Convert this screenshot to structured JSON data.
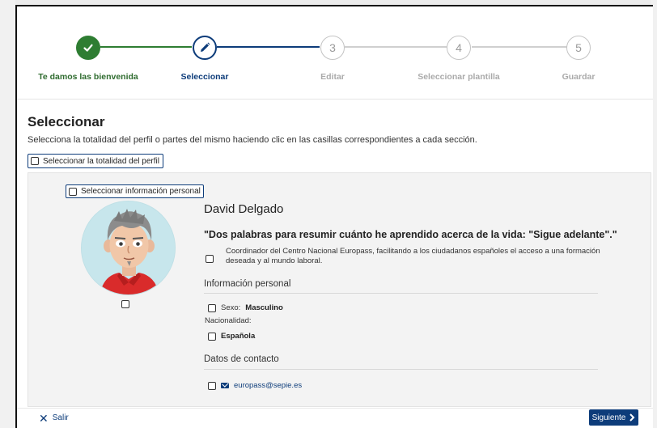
{
  "stepper": {
    "steps": [
      {
        "number": "1",
        "label": "Te damos las bienvenida",
        "state": "done"
      },
      {
        "number": "2",
        "label": "Seleccionar",
        "state": "active"
      },
      {
        "number": "3",
        "label": "Editar",
        "state": "pending"
      },
      {
        "number": "4",
        "label": "Seleccionar plantilla",
        "state": "pending"
      },
      {
        "number": "5",
        "label": "Guardar",
        "state": "pending"
      }
    ]
  },
  "page": {
    "title": "Seleccionar",
    "description": "Selecciona la totalidad del perfil o partes del mismo haciendo clic en las casillas correspondientes a cada sección.",
    "select_all_label": "Seleccionar la totalidad del perfil"
  },
  "profile": {
    "select_personal_label": "Seleccionar información personal",
    "name": "David Delgado",
    "quote": "\"Dos palabras para resumir cuánto he aprendido acerca de la vida: \"Sigue adelante\".\"",
    "summary": "Coordinador del Centro Nacional Europass, facilitando a los ciudadanos españoles el acceso a una formación deseada y al mundo laboral.",
    "personal_info_title": "Información personal",
    "sex_label": "Sexo:",
    "sex_value": "Masculino",
    "nationality_label": "Nacionalidad:",
    "nationality_value": "Española",
    "contact_title": "Datos de contacto",
    "email": "europass@sepie.es"
  },
  "footer": {
    "exit_label": "Salir",
    "next_label": "Siguiente"
  },
  "colors": {
    "primary": "#0d3c7a",
    "success": "#2e7d32"
  }
}
